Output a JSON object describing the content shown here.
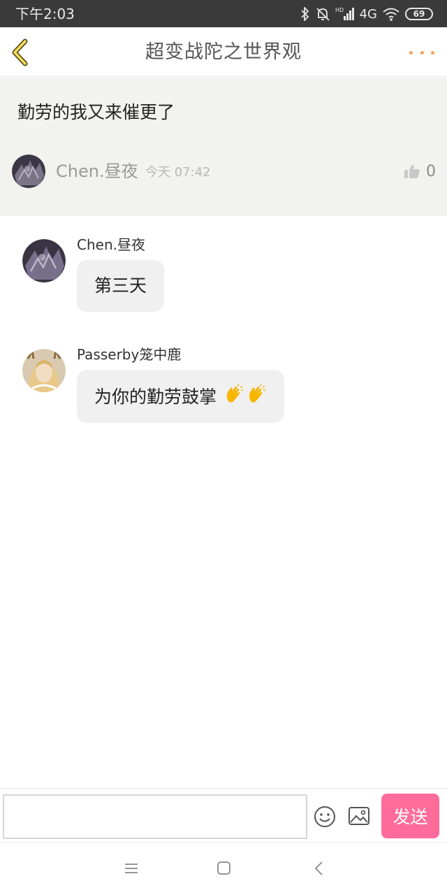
{
  "status_bar": {
    "time": "下午2:03",
    "network": "4G",
    "battery": "69"
  },
  "header": {
    "title": "超变战陀之世界观",
    "back_icon": "chevron-left-icon",
    "more_icon": "more-dots-icon"
  },
  "post": {
    "text": "勤劳的我又来催更了",
    "author": "Chen.昼夜",
    "time": "今天 07:42",
    "likes": "0"
  },
  "comments": [
    {
      "author": "Chen.昼夜",
      "text": "第三天"
    },
    {
      "author": "Passerby笼中鹿",
      "text": "为你的勤劳鼓掌"
    }
  ],
  "input_bar": {
    "placeholder": "",
    "send_label": "发送"
  },
  "colors": {
    "accent": "#ff6b9b",
    "more_dots": "#f5a15c",
    "panel_bg": "#f2f2ee"
  }
}
